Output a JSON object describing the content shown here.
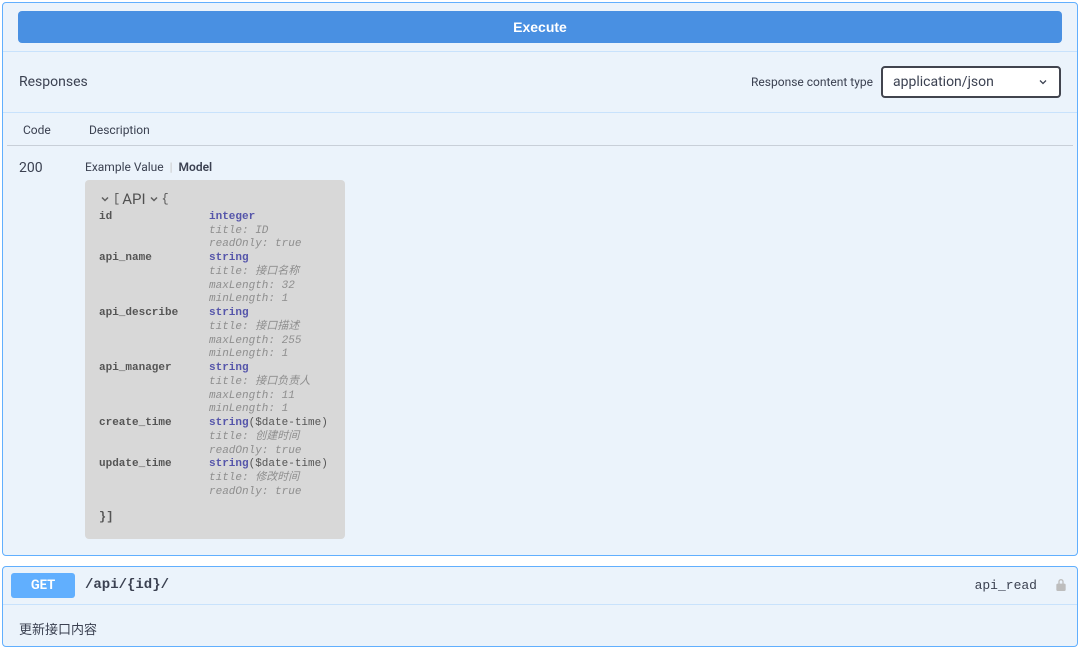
{
  "executeLabel": "Execute",
  "responsesTitle": "Responses",
  "contentTypeLabel": "Response content type",
  "contentTypeValue": "application/json",
  "columns": {
    "code": "Code",
    "description": "Description"
  },
  "response": {
    "code": "200",
    "tabs": {
      "example": "Example Value",
      "model": "Model"
    },
    "model": {
      "name": "API",
      "open": "[",
      "brace": "{",
      "closeRow": "}]",
      "fields": [
        {
          "name": "id",
          "type": "integer",
          "format": "",
          "meta": [
            "title: ID",
            "readOnly: true"
          ]
        },
        {
          "name": "api_name",
          "type": "string",
          "format": "",
          "meta": [
            "title: 接口名称",
            "maxLength: 32",
            "minLength: 1"
          ]
        },
        {
          "name": "api_describe",
          "type": "string",
          "format": "",
          "meta": [
            "title: 接口描述",
            "maxLength: 255",
            "minLength: 1"
          ]
        },
        {
          "name": "api_manager",
          "type": "string",
          "format": "",
          "meta": [
            "title: 接口负责人",
            "maxLength: 11",
            "minLength: 1"
          ]
        },
        {
          "name": "create_time",
          "type": "string",
          "format": "($date-time)",
          "meta": [
            "title: 创建时间",
            "readOnly: true"
          ]
        },
        {
          "name": "update_time",
          "type": "string",
          "format": "($date-time)",
          "meta": [
            "title: 修改时间",
            "readOnly: true"
          ]
        }
      ]
    }
  },
  "getOp": {
    "method": "GET",
    "path": "/api/{id}/",
    "opId": "api_read",
    "desc": "更新接口内容"
  }
}
